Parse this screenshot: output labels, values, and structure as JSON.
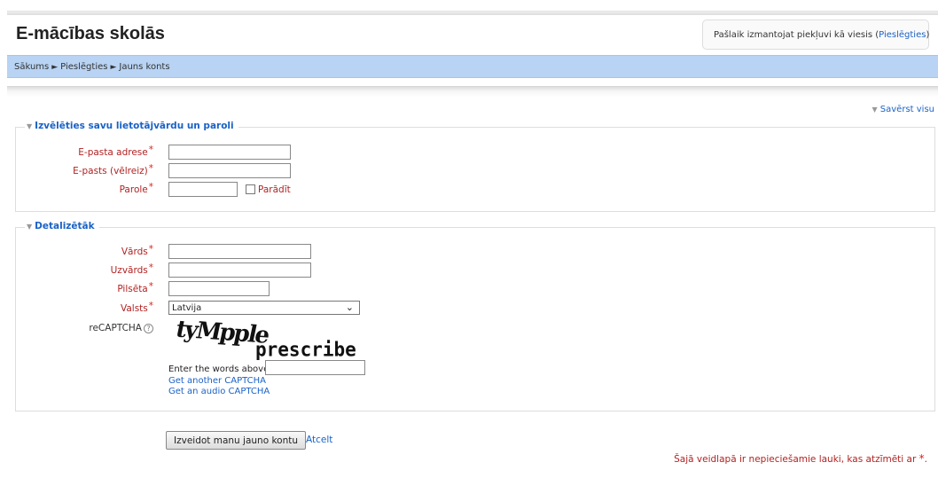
{
  "header": {
    "site_title": "E-mācības skolās",
    "login_info_prefix": "Pašlaik izmantojat piekļuvi kā viesis (",
    "login_link": "Pieslēgties",
    "login_info_suffix": ")"
  },
  "breadcrumb": {
    "items": [
      "Sākums",
      "Pieslēgties",
      "Jauns konts"
    ],
    "separator": "►"
  },
  "collapse_all": "Savērst visu",
  "section1": {
    "legend": "Izvēlēties savu lietotājvārdu un paroli",
    "email_label": "E-pasta adrese",
    "email_value": "",
    "email2_label": "E-pasts (vēlreiz)",
    "email2_value": "",
    "password_label": "Parole",
    "password_value": "",
    "show_label": "Parādīt"
  },
  "section2": {
    "legend": "Detalizētāk",
    "firstname_label": "Vārds",
    "lastname_label": "Uzvārds",
    "city_label": "Pilsēta",
    "country_label": "Valsts",
    "country_value": "Latvija",
    "recaptcha_label": "reCAPTCHA",
    "captcha_word1": "tyMpple",
    "captcha_word2": "prescribe",
    "enter_words_label": "Enter the words above",
    "another_captcha": "Get another CAPTCHA",
    "audio_captcha": "Get an audio CAPTCHA"
  },
  "required_mark": "*",
  "buttons": {
    "submit": "Izveidot manu jauno kontu",
    "cancel": "Atcelt"
  },
  "required_note": "Šajā veidlapā ir nepieciešamie lauki, kas atzīmēti ar",
  "required_note_end": "."
}
